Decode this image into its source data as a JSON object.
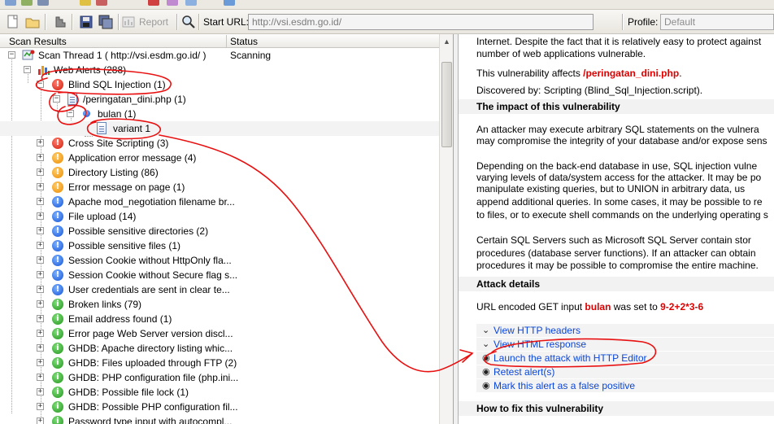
{
  "toolbar": {
    "report_label": "Report",
    "start_url_label": "Start URL:",
    "start_url_value": "http://vsi.esdm.go.id/",
    "profile_label": "Profile:",
    "profile_value": "Default"
  },
  "columns": {
    "scan_results": "Scan Results",
    "status": "Status"
  },
  "tree": {
    "scan_thread": {
      "label": "Scan Thread 1 ( http://vsi.esdm.go.id/ )",
      "status": "Scanning"
    },
    "web_alerts": "Web Alerts (288)",
    "blind_sql": "Blind SQL Injection (1)",
    "file": "/peringatan_dini.php (1)",
    "param": "bulan (1)",
    "variant": "variant 1",
    "alerts": [
      {
        "label": "Cross Site Scripting (3)",
        "sev": "red",
        "glyph": "!"
      },
      {
        "label": "Application error message (4)",
        "sev": "orange",
        "glyph": "!"
      },
      {
        "label": "Directory Listing (86)",
        "sev": "orange",
        "glyph": "!"
      },
      {
        "label": "Error message on page (1)",
        "sev": "orange",
        "glyph": "!"
      },
      {
        "label": "Apache mod_negotiation filename br...",
        "sev": "blue",
        "glyph": "!"
      },
      {
        "label": "File upload (14)",
        "sev": "blue",
        "glyph": "!"
      },
      {
        "label": "Possible sensitive directories (2)",
        "sev": "blue",
        "glyph": "!"
      },
      {
        "label": "Possible sensitive files (1)",
        "sev": "blue",
        "glyph": "!"
      },
      {
        "label": "Session Cookie without HttpOnly fla...",
        "sev": "blue",
        "glyph": "!"
      },
      {
        "label": "Session Cookie without Secure flag s...",
        "sev": "blue",
        "glyph": "!"
      },
      {
        "label": "User credentials are sent in clear te...",
        "sev": "blue",
        "glyph": "!"
      },
      {
        "label": "Broken links (79)",
        "sev": "green",
        "glyph": "i"
      },
      {
        "label": "Email address found (1)",
        "sev": "green",
        "glyph": "i"
      },
      {
        "label": "Error page Web Server version discl...",
        "sev": "green",
        "glyph": "i"
      },
      {
        "label": "GHDB: Apache directory listing whic...",
        "sev": "green",
        "glyph": "i"
      },
      {
        "label": "GHDB: Files uploaded through FTP (2)",
        "sev": "green",
        "glyph": "i"
      },
      {
        "label": "GHDB: PHP configuration file (php.ini...",
        "sev": "green",
        "glyph": "i"
      },
      {
        "label": "GHDB: Possible file lock (1)",
        "sev": "green",
        "glyph": "i"
      },
      {
        "label": "GHDB: Possible PHP configuration fil...",
        "sev": "green",
        "glyph": "i"
      },
      {
        "label": "Password type input with autocompl...",
        "sev": "green",
        "glyph": "i"
      }
    ]
  },
  "details": {
    "intro_lines": [
      "Internet. Despite the fact that it is relatively easy to protect against",
      "number of web applications vulnerable."
    ],
    "affects_prefix": "This vulnerability affects ",
    "affects_value": "/peringatan_dini.php",
    "affects_suffix": ".",
    "discovered": "Discovered by: Scripting (Blind_Sql_Injection.script).",
    "impact_header": "The impact of this vulnerability",
    "para1": [
      "An attacker may execute arbitrary SQL statements on the vulnera",
      "may compromise the integrity of your database and/or expose sens"
    ],
    "para2": [
      "Depending on the back-end database in use, SQL injection vulne",
      "varying levels of data/system access for the attacker. It may be po",
      "manipulate existing queries, but to UNION in arbitrary data, us",
      "append additional queries. In some cases, it may be possible to re",
      "to files, or to execute shell commands on the underlying operating s"
    ],
    "para3": [
      "Certain SQL Servers such as Microsoft SQL Server contain stor",
      "procedures (database server functions). If an attacker can obtain",
      "procedures it may be possible to compromise the entire machine."
    ],
    "attack_header": "Attack details",
    "attack_prefix": "URL encoded GET input ",
    "attack_param": "bulan",
    "attack_mid": " was set to ",
    "attack_value": "9-2+2*3-6",
    "actions": [
      {
        "label": "View HTTP headers",
        "marker": "⌄"
      },
      {
        "label": "View HTML response",
        "marker": "⌄"
      },
      {
        "label": "Launch the attack with HTTP Editor",
        "marker": "◉"
      },
      {
        "label": "Retest alert(s)",
        "marker": "◉"
      },
      {
        "label": "Mark this alert as a false positive",
        "marker": "◉"
      }
    ],
    "fix_header": "How to fix this vulnerability"
  }
}
